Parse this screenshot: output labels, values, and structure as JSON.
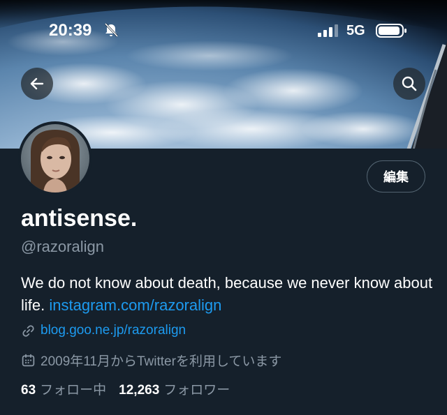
{
  "status_bar": {
    "time": "20:39",
    "network": "5G"
  },
  "icons": {
    "back": "arrow-left-icon",
    "search": "search-icon",
    "bell_muted": "bell-slash-icon",
    "link": "link-icon",
    "calendar": "calendar-icon"
  },
  "profile": {
    "edit_label": "編集",
    "display_name": "antisense.",
    "handle": "@razoralign",
    "bio_text": "We do not know about death, because we never know about life.",
    "bio_link": "instagram.com/razoralign",
    "website": "blog.goo.ne.jp/razoralign",
    "joined": "2009年11月からTwitterを利用しています",
    "following_count": "63",
    "following_label": "フォロー中",
    "followers_count": "12,263",
    "followers_label": "フォロワー"
  },
  "colors": {
    "background": "#15202b",
    "link": "#1d9bf0",
    "secondary_text": "#8b98a5"
  }
}
